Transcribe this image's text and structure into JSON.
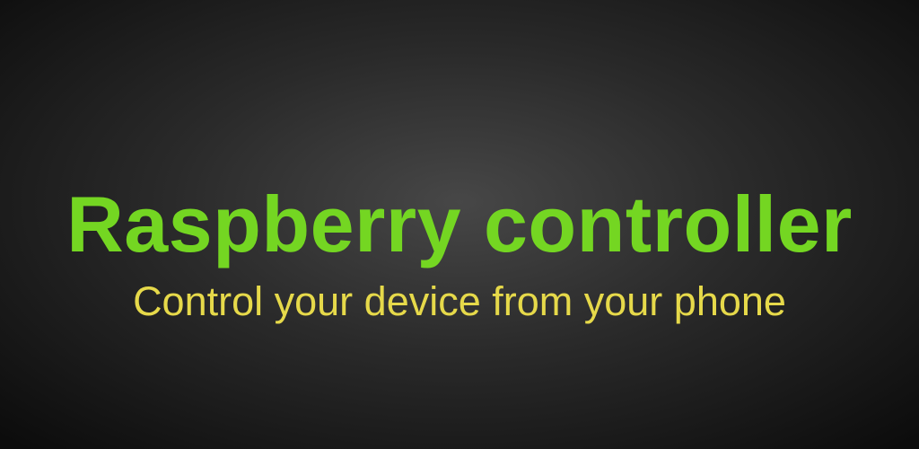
{
  "banner": {
    "title": "Raspberry controller",
    "subtitle": "Control your device from your phone",
    "colors": {
      "title": "#74d622",
      "subtitle": "#e6d94a",
      "background_center": "#474747",
      "background_edge": "#0c0c0c"
    }
  }
}
